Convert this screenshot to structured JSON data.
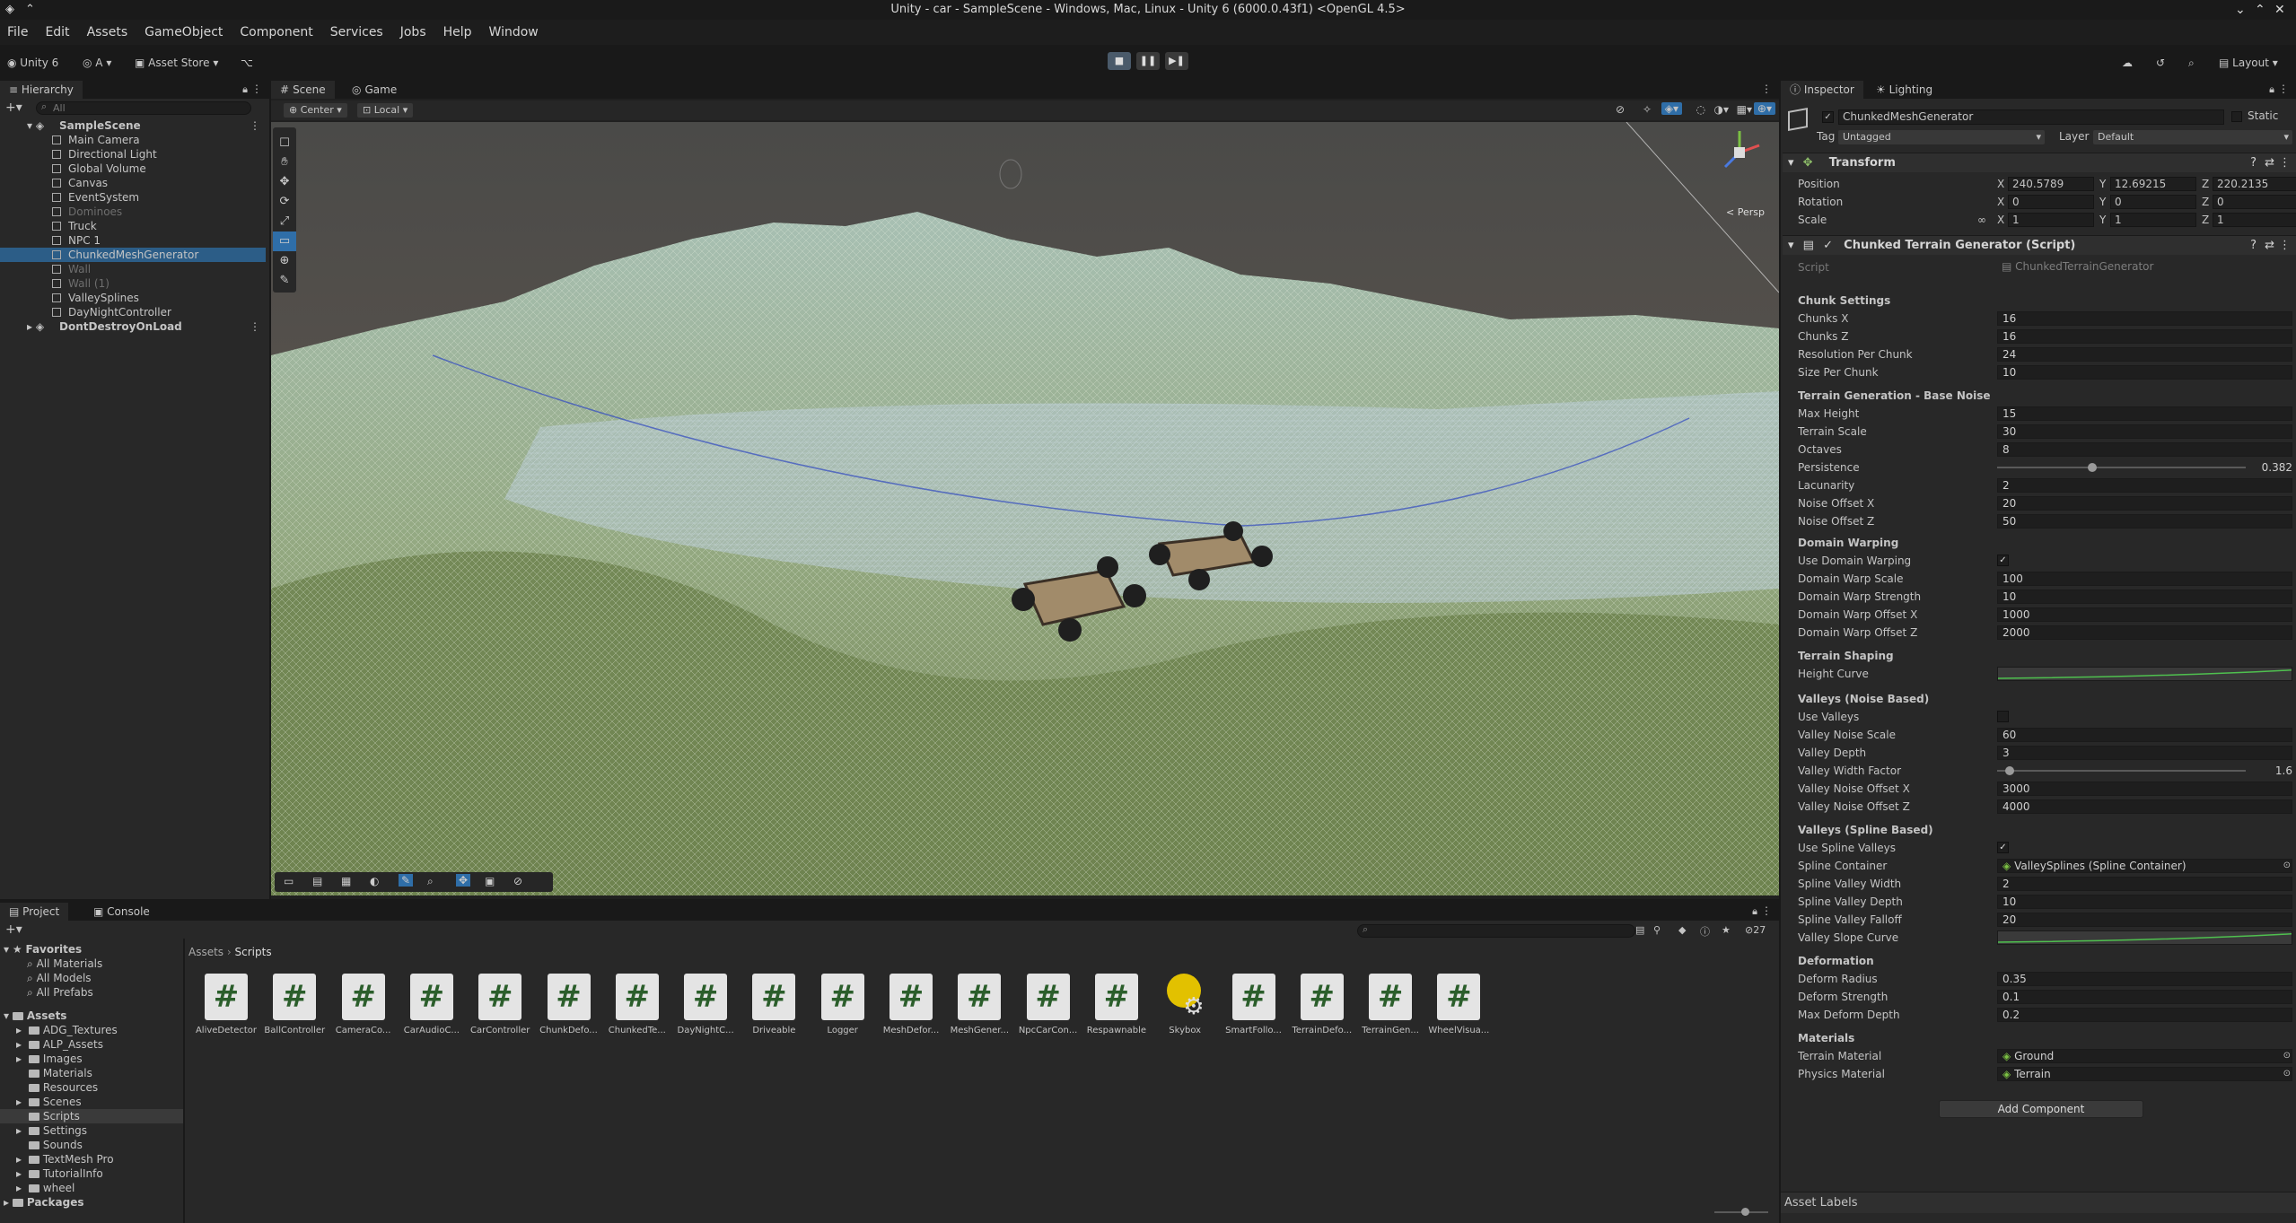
{
  "window": {
    "title": "Unity - car - SampleScene - Windows, Mac, Linux - Unity 6 (6000.0.43f1) <OpenGL 4.5>"
  },
  "menu": [
    "File",
    "Edit",
    "Assets",
    "GameObject",
    "Component",
    "Services",
    "Jobs",
    "Help",
    "Window"
  ],
  "toolbar": {
    "account": "Unity 6",
    "user": "A",
    "asset_store": "Asset Store",
    "layout": "Layout"
  },
  "hierarchy": {
    "tab": "Hierarchy",
    "search_placeholder": "All",
    "items": [
      {
        "label": "SampleScene",
        "indent": 0,
        "scene": true
      },
      {
        "label": "Main Camera",
        "indent": 2
      },
      {
        "label": "Directional Light",
        "indent": 2
      },
      {
        "label": "Global Volume",
        "indent": 2
      },
      {
        "label": "Canvas",
        "indent": 2
      },
      {
        "label": "EventSystem",
        "indent": 2
      },
      {
        "label": "Dominoes",
        "indent": 2,
        "dim": true
      },
      {
        "label": "Truck",
        "indent": 2
      },
      {
        "label": "NPC 1",
        "indent": 2
      },
      {
        "label": "ChunkedMeshGenerator",
        "indent": 2,
        "selected": true
      },
      {
        "label": "Wall",
        "indent": 2,
        "dim": true
      },
      {
        "label": "Wall (1)",
        "indent": 2,
        "dim": true
      },
      {
        "label": "ValleySplines",
        "indent": 2
      },
      {
        "label": "DayNightController",
        "indent": 2
      },
      {
        "label": "DontDestroyOnLoad",
        "indent": 0,
        "scene": true
      }
    ]
  },
  "scene_view": {
    "tabs": [
      "Scene",
      "Game"
    ],
    "pivot": "Center",
    "space": "Local",
    "gizmo_label": "< Persp"
  },
  "inspector": {
    "tabs": [
      "Inspector",
      "Lighting"
    ],
    "object_name": "ChunkedMeshGenerator",
    "static_label": "Static",
    "tag_label": "Tag",
    "tag_value": "Untagged",
    "layer_label": "Layer",
    "layer_value": "Default",
    "transform": {
      "title": "Transform",
      "position": {
        "label": "Position",
        "x": "240.5789",
        "y": "12.69215",
        "z": "220.2135"
      },
      "rotation": {
        "label": "Rotation",
        "x": "0",
        "y": "0",
        "z": "0"
      },
      "scale": {
        "label": "Scale",
        "x": "1",
        "y": "1",
        "z": "1"
      }
    },
    "script_component": {
      "title": "Chunked Terrain Generator (Script)",
      "script_label": "Script",
      "script_value": "ChunkedTerrainGenerator"
    },
    "sections": {
      "chunk": "Chunk Settings",
      "base_noise": "Terrain Generation - Base Noise",
      "domain": "Domain Warping",
      "shaping": "Terrain Shaping",
      "valleys_noise": "Valleys (Noise Based)",
      "valleys_spline": "Valleys (Spline Based)",
      "deformation": "Deformation",
      "materials": "Materials"
    },
    "fields": {
      "chunks_x": {
        "label": "Chunks X",
        "value": "16"
      },
      "chunks_z": {
        "label": "Chunks Z",
        "value": "16"
      },
      "resolution": {
        "label": "Resolution Per Chunk",
        "value": "24"
      },
      "size": {
        "label": "Size Per Chunk",
        "value": "10"
      },
      "max_height": {
        "label": "Max Height",
        "value": "15"
      },
      "terrain_scale": {
        "label": "Terrain Scale",
        "value": "30"
      },
      "octaves": {
        "label": "Octaves",
        "value": "8"
      },
      "persistence": {
        "label": "Persistence",
        "value": "0.382",
        "fraction": 0.382
      },
      "lacunarity": {
        "label": "Lacunarity",
        "value": "2"
      },
      "noise_offset_x": {
        "label": "Noise Offset X",
        "value": "20"
      },
      "noise_offset_z": {
        "label": "Noise Offset Z",
        "value": "50"
      },
      "use_domain_warping": {
        "label": "Use Domain Warping",
        "checked": true
      },
      "domain_warp_scale": {
        "label": "Domain Warp Scale",
        "value": "100"
      },
      "domain_warp_strength": {
        "label": "Domain Warp Strength",
        "value": "10"
      },
      "domain_warp_offset_x": {
        "label": "Domain Warp Offset X",
        "value": "1000"
      },
      "domain_warp_offset_z": {
        "label": "Domain Warp Offset Z",
        "value": "2000"
      },
      "height_curve": {
        "label": "Height Curve"
      },
      "use_valleys": {
        "label": "Use Valleys",
        "checked": false
      },
      "valley_noise_scale": {
        "label": "Valley Noise Scale",
        "value": "60"
      },
      "valley_depth": {
        "label": "Valley Depth",
        "value": "3"
      },
      "valley_width_factor": {
        "label": "Valley Width Factor",
        "value": "1.6",
        "fraction": 0.05
      },
      "valley_noise_offset_x": {
        "label": "Valley Noise Offset X",
        "value": "3000"
      },
      "valley_noise_offset_z": {
        "label": "Valley Noise Offset Z",
        "value": "4000"
      },
      "use_spline_valleys": {
        "label": "Use Spline Valleys",
        "checked": true
      },
      "spline_container": {
        "label": "Spline Container",
        "value": "ValleySplines (Spline Container)"
      },
      "spline_valley_width": {
        "label": "Spline Valley Width",
        "value": "2"
      },
      "spline_valley_depth": {
        "label": "Spline Valley Depth",
        "value": "10"
      },
      "spline_valley_falloff": {
        "label": "Spline Valley Falloff",
        "value": "20"
      },
      "valley_slope_curve": {
        "label": "Valley Slope Curve"
      },
      "deform_radius": {
        "label": "Deform Radius",
        "value": "0.35"
      },
      "deform_strength": {
        "label": "Deform Strength",
        "value": "0.1"
      },
      "max_deform_depth": {
        "label": "Max Deform Depth",
        "value": "0.2"
      },
      "terrain_material": {
        "label": "Terrain Material",
        "value": "Ground"
      },
      "physics_material": {
        "label": "Physics Material",
        "value": "Terrain"
      }
    },
    "add_component": "Add Component",
    "asset_labels": "Asset Labels"
  },
  "project": {
    "tabs": [
      "Project",
      "Console"
    ],
    "breadcrumb": [
      "Assets",
      "Scripts"
    ],
    "hidden_count": "27",
    "favorites_label": "Favorites",
    "favorites": [
      "All Materials",
      "All Models",
      "All Prefabs"
    ],
    "assets_label": "Assets",
    "folders": [
      "ADG_Textures",
      "ALP_Assets",
      "Images",
      "Materials",
      "Resources",
      "Scenes",
      "Scripts",
      "Settings",
      "Sounds",
      "TextMesh Pro",
      "TutorialInfo",
      "wheel"
    ],
    "packages_label": "Packages",
    "files": [
      "AliveDetector",
      "BallController",
      "CameraCo...",
      "CarAudioC...",
      "CarController",
      "ChunkDefo...",
      "ChunkedTe...",
      "DayNightC...",
      "Driveable",
      "Logger",
      "MeshDefor...",
      "MeshGener...",
      "NpcCarCon...",
      "Respawnable",
      "Skybox",
      "SmartFollo...",
      "TerrainDefo...",
      "TerrainGen...",
      "WheelVisua..."
    ]
  },
  "colors": {
    "selection": "#2c5d87",
    "panel": "#282828",
    "accent_green": "#2b5e2b"
  }
}
